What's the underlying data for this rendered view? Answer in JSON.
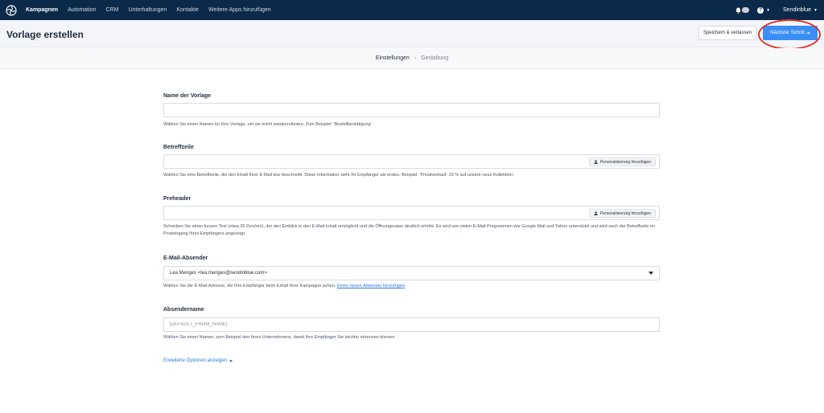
{
  "nav": {
    "items": [
      {
        "label": "Kampagnen",
        "active": true
      },
      {
        "label": "Automation",
        "active": false
      },
      {
        "label": "CRM",
        "active": false
      },
      {
        "label": "Unterhaltungen",
        "active": false
      },
      {
        "label": "Kontakte",
        "active": false
      },
      {
        "label": "Weitere Apps hinzufügen",
        "active": false
      }
    ],
    "help_label": "?",
    "account_label": "Sendinblue"
  },
  "header": {
    "title": "Vorlage erstellen",
    "save_label": "Speichern & verlassen",
    "next_label": "Nächster Schritt",
    "next_arrow": "➔"
  },
  "steps": {
    "current": "Einstellungen",
    "separator": "›",
    "next": "Gestaltung"
  },
  "form": {
    "name": {
      "label": "Name der Vorlage",
      "value": "",
      "help": "Wählen Sie einen Namen für Ihre Vorlage, um sie leicht wiederzufinden. Zum Beispiel: 'Bestellbestätigung'."
    },
    "subject": {
      "label": "Betreffzeile",
      "value": "",
      "personalize_label": "Personalisierung hinzufügen",
      "help": "Wählen Sie eine Betreffzeile, die den Inhalt Ihrer E-Mail klar beschreibt. Diese Information sieht Ihr Empfänger als erstes. Beispiel: 'Privatverkauf: 25 % auf unsere neue Kollektion'."
    },
    "preheader": {
      "label": "Preheader",
      "value": "",
      "personalize_label": "Personalisierung hinzufügen",
      "help": "Schreiben Sie einen kurzen Text (etwa 35 Zeichen), der den Einblick in den E-Mail-Inhalt ermöglicht und die Öffnungsraten deutlich erhöht. Es wird von vielen E-Mail-Programmen wie Google Mail und Yahoo unterstützt und wird nach der Betreffzeile im Posteingang Ihres Empfängers angezeigt."
    },
    "sender": {
      "label": "E-Mail-Absender",
      "value": "Lea Menges <lea.menges@sendinblue.com>",
      "help": "Wählen Sie die E-Mail-Adresse, die Ihre Empfänger beim Erhalt Ihrer Kampagne sehen.",
      "help_link": "Einen neuen Absender hinzufügen"
    },
    "sender_name": {
      "label": "Absendername",
      "placeholder": "[DEFAULT_FROM_NAME]",
      "help": "Wählen Sie einen Namen, zum Beispiel den Ihres Unternehmens, damit Ihre Empfänger Sie leichter erkennen können."
    },
    "advanced_label": "Erweiterte Optionen anzeigen"
  },
  "colors": {
    "nav_bg": "#0b2a4a",
    "accent": "#3a8ef6",
    "highlight": "#e0312b",
    "link": "#2a79e4"
  }
}
